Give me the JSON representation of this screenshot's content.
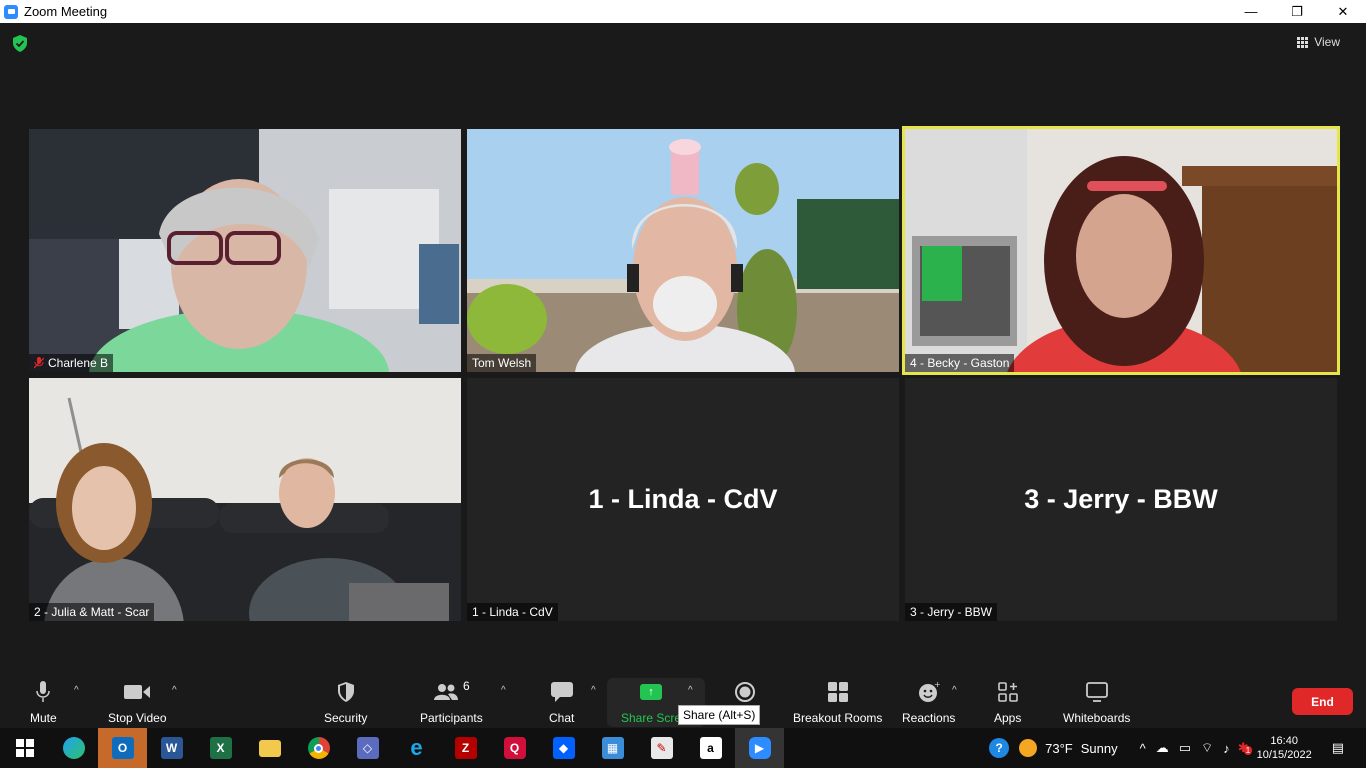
{
  "window": {
    "title": "Zoom Meeting",
    "minimize": "—",
    "restore": "❐",
    "close": "✕"
  },
  "header": {
    "view_label": "View"
  },
  "tiles": [
    {
      "name": "Charlene B",
      "muted": true
    },
    {
      "name": "Tom Welsh"
    },
    {
      "name": "4 - Becky - Gaston",
      "active": true
    },
    {
      "name": "2 - Julia & Matt - Scar"
    },
    {
      "name": "1 - Linda - CdV",
      "big": "1 - Linda - CdV"
    },
    {
      "name": "3 - Jerry - BBW",
      "big": "3 - Jerry - BBW"
    }
  ],
  "controls": {
    "mute": "Mute",
    "stop_video": "Stop Video",
    "security": "Security",
    "participants": "Participants",
    "participants_count": "6",
    "chat": "Chat",
    "share_screen": "Share Scre",
    "record": "d",
    "breakout": "Breakout Rooms",
    "reactions": "Reactions",
    "apps": "Apps",
    "whiteboards": "Whiteboards",
    "end": "End",
    "tooltip": "Share (Alt+S)"
  },
  "taskbar": {
    "weather_temp": "73°F",
    "weather_desc": "Sunny",
    "time": "16:40",
    "date": "10/15/2022",
    "notification_badge": "1"
  },
  "colors": {
    "share_green": "#23c552",
    "end_red": "#e02828",
    "active_speaker": "#e6e64a"
  }
}
